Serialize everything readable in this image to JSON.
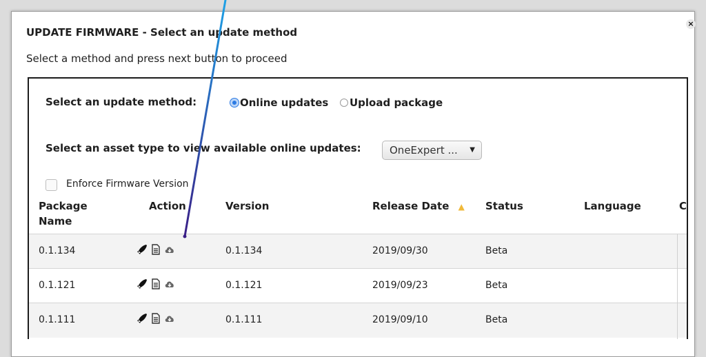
{
  "dialog": {
    "title": "UPDATE FIRMWARE - Select an update method",
    "subtitle": "Select a method and press next button to proceed",
    "close_icon": "×"
  },
  "method": {
    "label": "Select an update method:",
    "options": [
      {
        "label": "Online updates",
        "selected": true
      },
      {
        "label": "Upload package",
        "selected": false
      }
    ]
  },
  "asset": {
    "label": "Select an asset type to view available online updates:",
    "selected": "OneExpert ...",
    "caret": "▼"
  },
  "enforce": {
    "label": "Enforce Firmware Version",
    "checked": false
  },
  "table": {
    "headers": {
      "package_name": "Package Name",
      "action": "Action",
      "version": "Version",
      "release_date": "Release Date",
      "status": "Status",
      "language": "Language",
      "truncated": "Co"
    },
    "sort_icon": "▲",
    "rows": [
      {
        "package": "0.1.134",
        "version": "0.1.134",
        "date": "2019/09/30",
        "status": "Beta"
      },
      {
        "package": "0.1.121",
        "version": "0.1.121",
        "date": "2019/09/23",
        "status": "Beta"
      },
      {
        "package": "0.1.111",
        "version": "0.1.111",
        "date": "2019/09/10",
        "status": "Beta"
      }
    ]
  },
  "icons": [
    "rocket-icon",
    "document-icon",
    "cloud-download-icon"
  ],
  "colors": {
    "accent": "#2d7be3",
    "annotation_top": "#1ea1e6",
    "annotation_bottom": "#3a1e86",
    "sort_icon": "#f0b93a"
  }
}
